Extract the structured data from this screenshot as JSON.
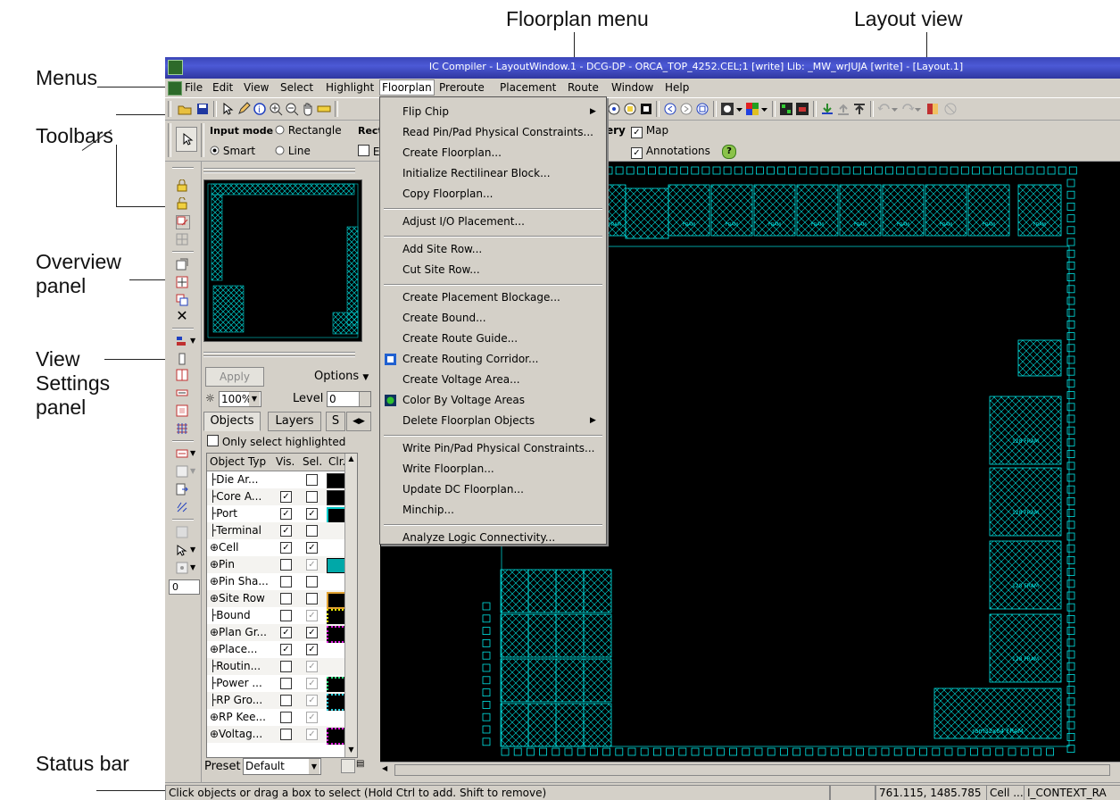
{
  "callouts": {
    "menus": "Menus",
    "toolbars": "Toolbars",
    "overview": "Overview\npanel",
    "view_settings": "View\nSettings\npanel",
    "status_bar": "Status bar",
    "floorplan_menu": "Floorplan menu",
    "layout_view": "Layout view"
  },
  "window": {
    "title": "IC Compiler - LayoutWindow.1 - DCG-DP - ORCA_TOP_4252.CEL;1 [write]    Lib: _MW_wrJUJA [write] - [Layout.1]"
  },
  "menubar": [
    "File",
    "Edit",
    "View",
    "Select",
    "Highlight",
    "Floorplan",
    "Preroute",
    "Placement",
    "Route",
    "Window",
    "Help"
  ],
  "toolbar2": {
    "input_mode_label": "Input mode",
    "rectangle": "Rectangle",
    "smart": "Smart",
    "line": "Line",
    "rect_trunc": "Rect",
    "e_trunc": "E",
    "query_trunc": "ery",
    "map": "Map",
    "annotations": "Annotations"
  },
  "floorplan_menu": {
    "items": [
      {
        "label": "Flip Chip",
        "submenu": true
      },
      {
        "label": "Read Pin/Pad Physical Constraints..."
      },
      {
        "label": "Create Floorplan..."
      },
      {
        "label": "Initialize Rectilinear Block..."
      },
      {
        "label": "Copy Floorplan..."
      },
      {
        "sep": true
      },
      {
        "label": "Adjust I/O Placement..."
      },
      {
        "sep": true
      },
      {
        "label": "Add Site Row..."
      },
      {
        "label": "Cut Site Row..."
      },
      {
        "sep": true
      },
      {
        "label": "Create Placement Blockage..."
      },
      {
        "label": "Create Bound..."
      },
      {
        "label": "Create Route Guide..."
      },
      {
        "label": "Create Routing Corridor...",
        "icon": "routing-corridor-icon"
      },
      {
        "label": "Create Voltage Area..."
      },
      {
        "label": "Color By Voltage Areas",
        "icon": "voltage-areas-icon"
      },
      {
        "label": "Delete Floorplan Objects",
        "submenu": true
      },
      {
        "sep": true
      },
      {
        "label": "Write Pin/Pad Physical Constraints..."
      },
      {
        "label": "Write Floorplan..."
      },
      {
        "label": "Update DC Floorplan..."
      },
      {
        "label": "Minchip..."
      },
      {
        "sep": true
      },
      {
        "label": "Analyze Logic Connectivity..."
      }
    ]
  },
  "view_settings": {
    "apply": "Apply",
    "options": "Options",
    "zoom": "100%",
    "level_label": "Level",
    "level_value": "0",
    "tabs": [
      "Objects",
      "Layers",
      "S"
    ],
    "only_select_highlighted": "Only select highlighted",
    "columns": [
      "Object Typ",
      "Vis.",
      "Sel.",
      "Clr."
    ],
    "rows": [
      {
        "name": "Die Ar...",
        "vis": null,
        "sel": false,
        "swatch": "black"
      },
      {
        "name": "Core A...",
        "vis": true,
        "sel": false,
        "swatch": "black"
      },
      {
        "name": "Port",
        "vis": true,
        "sel": true,
        "swatch": "cyan-outline"
      },
      {
        "name": "Terminal",
        "vis": true,
        "sel": false,
        "swatch": "none"
      },
      {
        "name": "Cell",
        "vis": true,
        "sel": true,
        "swatch": "none",
        "expand": true
      },
      {
        "name": "Pin",
        "vis": false,
        "sel": true,
        "swatch": "cyan-fill",
        "expand": true
      },
      {
        "name": "Pin Sha...",
        "vis": false,
        "sel": false,
        "swatch": "none",
        "expand": true
      },
      {
        "name": "Site Row",
        "vis": false,
        "sel": false,
        "swatch": "orange-outline",
        "expand": true
      },
      {
        "name": "Bound",
        "vis": false,
        "sel": true,
        "swatch": "yellow-dots"
      },
      {
        "name": "Plan Gr...",
        "vis": true,
        "sel": true,
        "swatch": "magenta-dots",
        "expand": true
      },
      {
        "name": "Place...",
        "vis": true,
        "sel": true,
        "swatch": "none",
        "expand": true
      },
      {
        "name": "Routin...",
        "vis": false,
        "sel": true,
        "swatch": "none"
      },
      {
        "name": "Power ...",
        "vis": false,
        "sel": true,
        "swatch": "green-dots"
      },
      {
        "name": "RP Gro...",
        "vis": false,
        "sel": true,
        "swatch": "cyan-dots"
      },
      {
        "name": "RP Kee...",
        "vis": false,
        "sel": true,
        "swatch": "none",
        "expand": true
      },
      {
        "name": "Voltag...",
        "vis": false,
        "sel": true,
        "swatch": "magenta-dots",
        "expand": true
      }
    ],
    "preset_label": "Preset",
    "preset_value": "Default"
  },
  "left_tool_input": "0",
  "status": {
    "message": "Click objects or drag a box to select (Hold Ctrl to add. Shift to remove)",
    "coords": "761.115, 1485.785",
    "cell": "Cell ...",
    "context": "I_CONTEXT_RA"
  },
  "layout_macro_labels": {
    "fram": "FRAM",
    "r128": "128 FRAM",
    "bigram": "ram32x64 FRAM"
  },
  "colors": {
    "cyan": "#00e5e5",
    "titlebar": "#3b46b8",
    "chrome": "#d4d0c8"
  }
}
